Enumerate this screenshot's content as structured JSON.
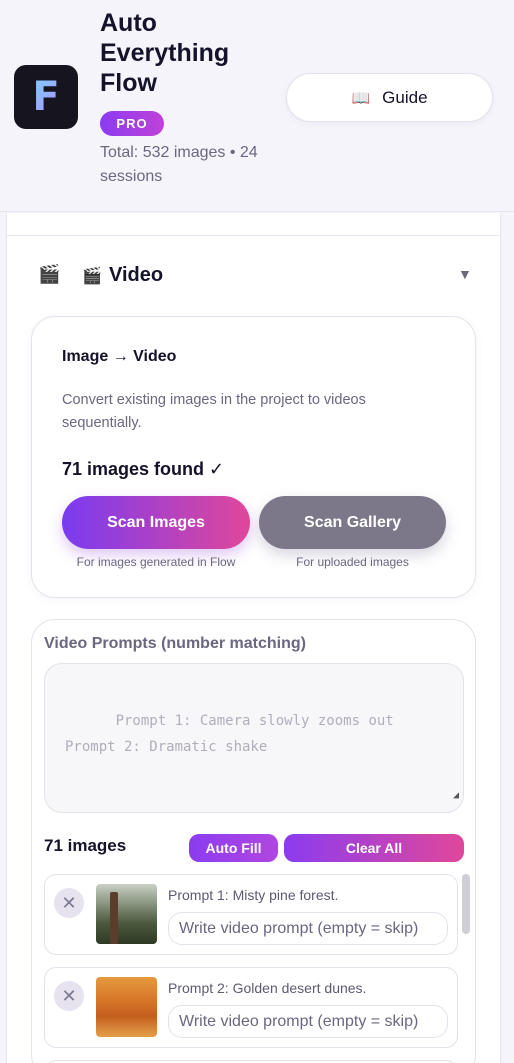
{
  "header": {
    "logo_letter": "F",
    "title": "Auto Everything Flow",
    "badge": "PRO",
    "stats": "Total: 532 images • 24 sessions",
    "guide_icon": "book-icon",
    "guide_label": "Guide"
  },
  "video_section": {
    "icon": "clapperboard-icon",
    "title_emoji": "🎬",
    "title": "Video",
    "collapse_icon": "triangle-down-icon"
  },
  "image_to_video": {
    "title": "Image → Video",
    "description": "Convert existing images in the project to videos sequentially.",
    "found": "71 images found ✓",
    "scan_images_label": "Scan Images",
    "scan_images_hint": "For images generated in Flow",
    "scan_gallery_label": "Scan Gallery",
    "scan_gallery_hint": "For uploaded images"
  },
  "prompts": {
    "title": "Video Prompts (number matching)",
    "placeholder": "Prompt 1: Camera slowly zooms out\nPrompt 2: Dramatic shake",
    "count_label": "71 images",
    "auto_fill_label": "Auto Fill",
    "clear_all_label": "Clear All",
    "items": [
      {
        "label": "Prompt 1: Misty pine forest.",
        "placeholder": "Write video prompt (empty = skip)",
        "thumb": "forest"
      },
      {
        "label": "Prompt 2: Golden desert dunes.",
        "placeholder": "Write video prompt (empty = skip)",
        "thumb": "desert"
      }
    ]
  }
}
